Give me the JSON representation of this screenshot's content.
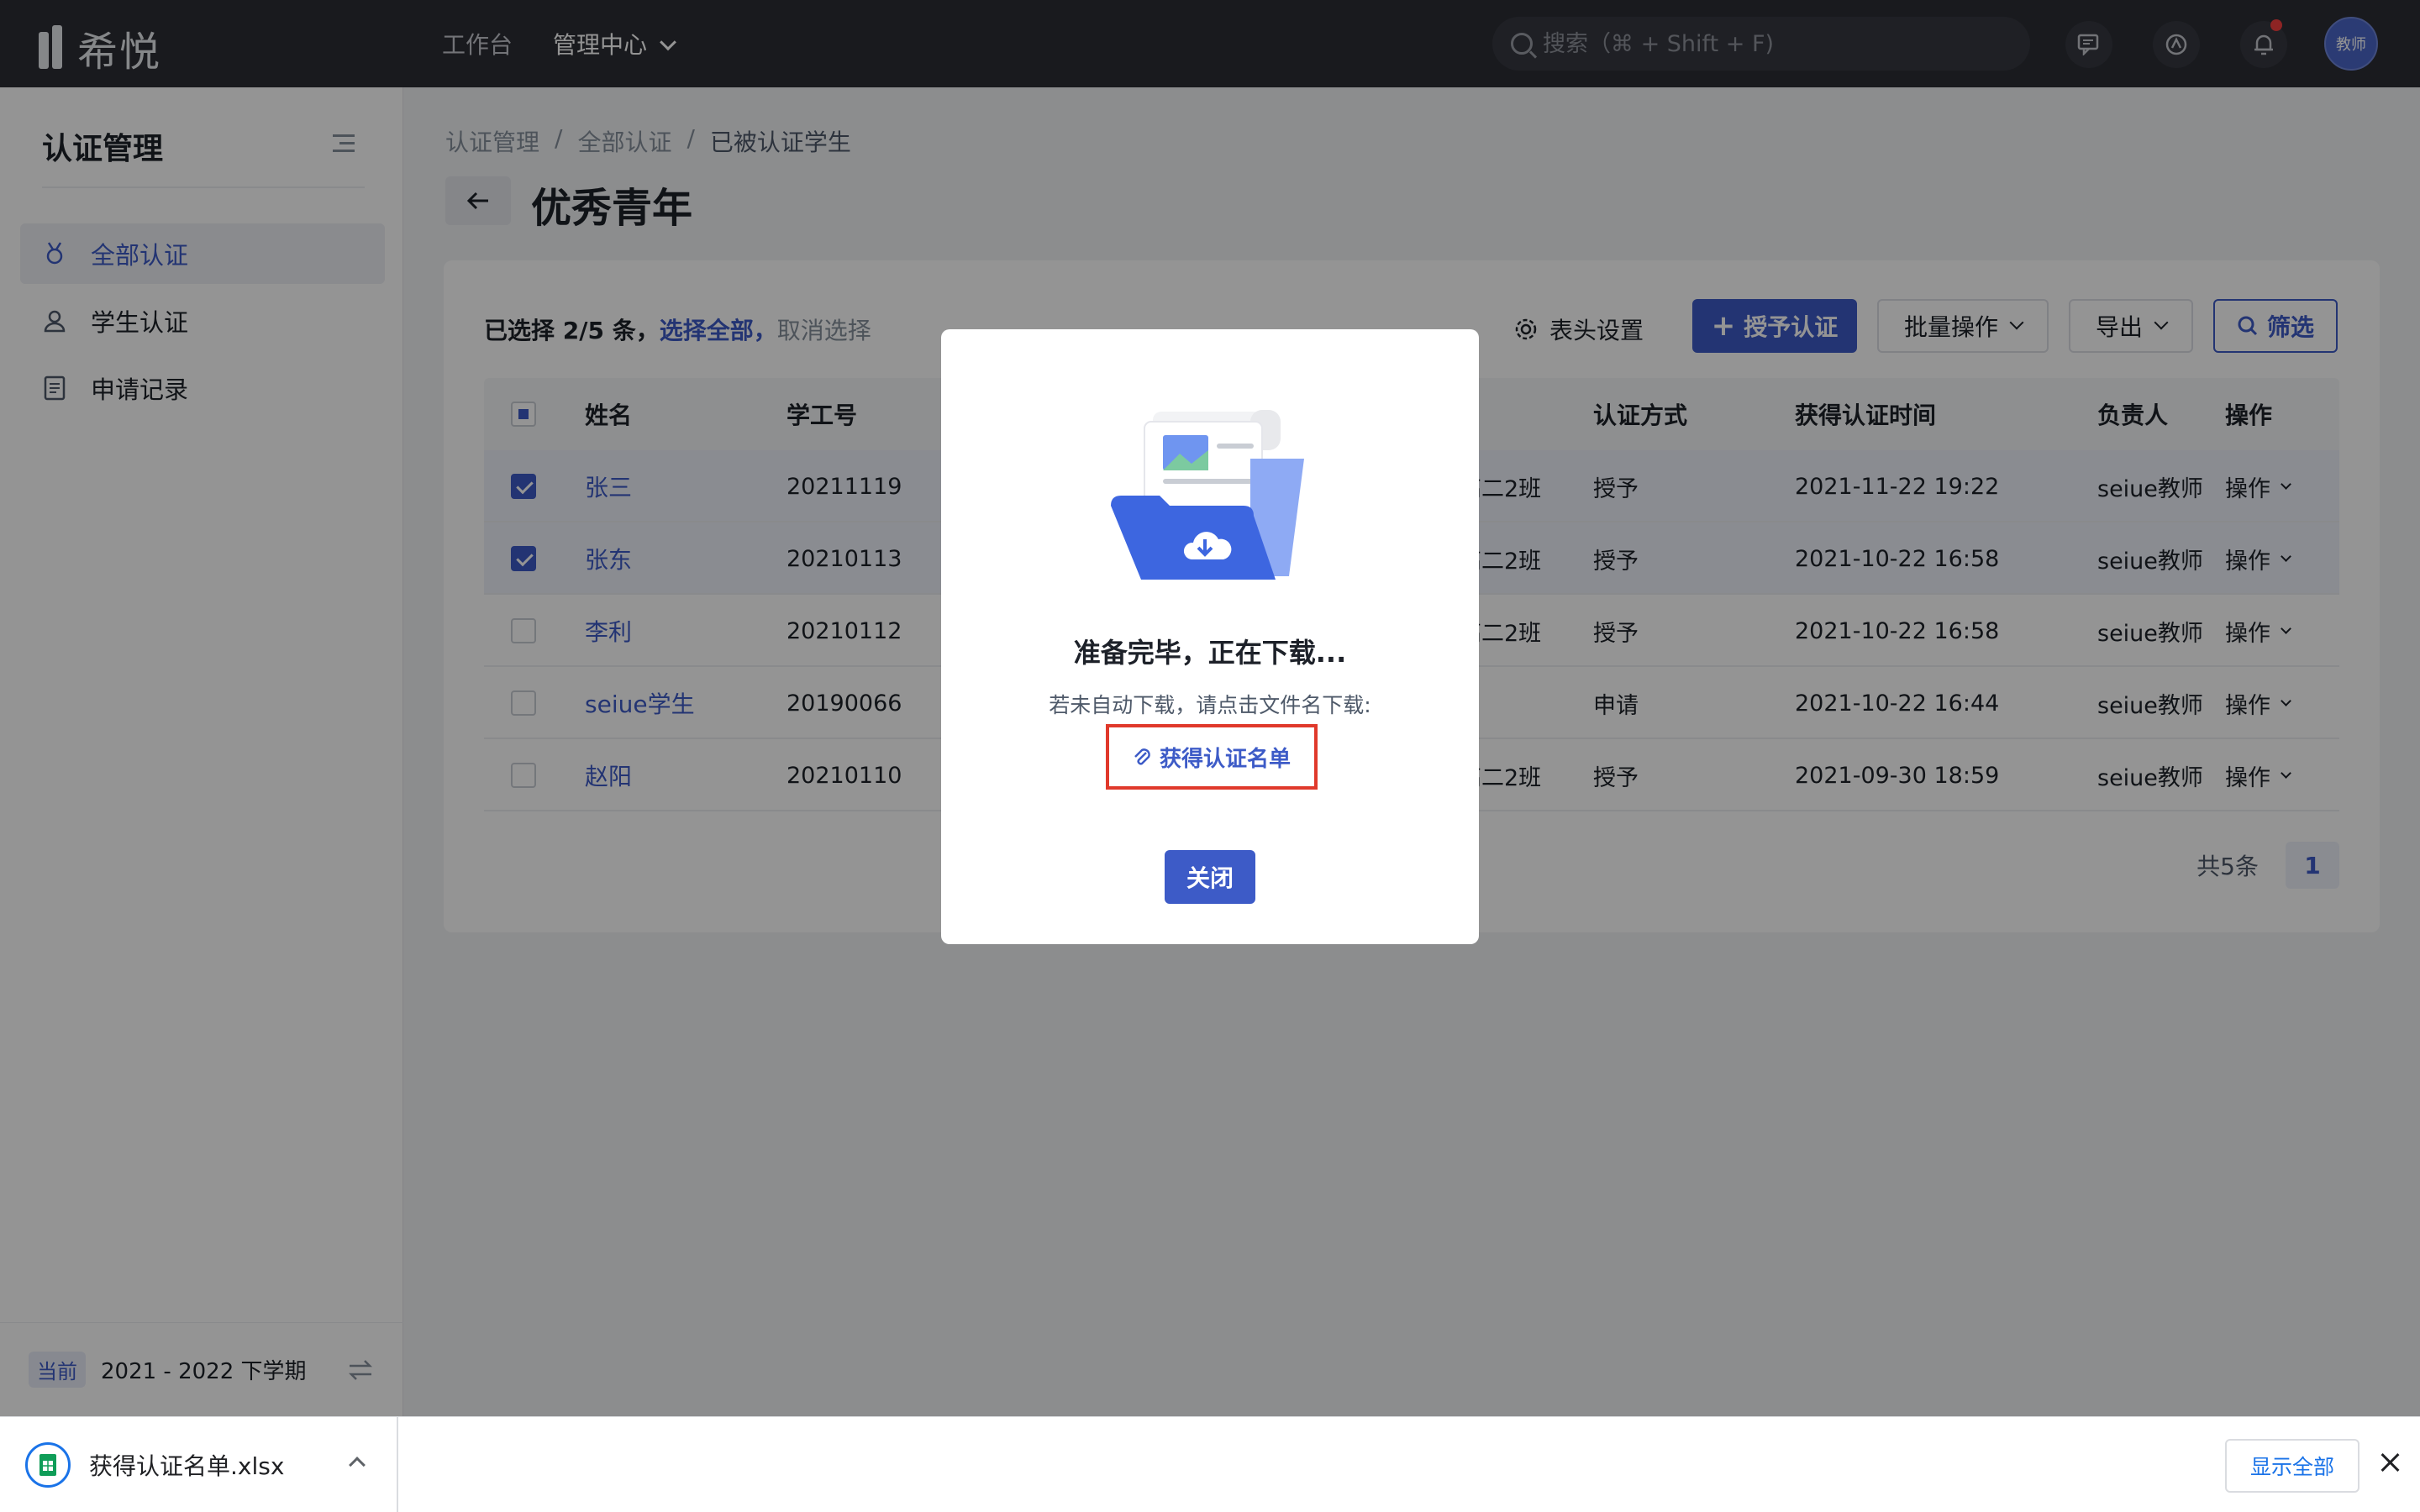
{
  "topbar": {
    "logo_text": "希悦",
    "nav": [
      {
        "label": "工作台"
      },
      {
        "label": "管理中心"
      }
    ],
    "search_placeholder": "搜索（⌘ + Shift + F)",
    "avatar_text": "教师"
  },
  "sidebar": {
    "title": "认证管理",
    "items": [
      {
        "label": "全部认证"
      },
      {
        "label": "学生认证"
      },
      {
        "label": "申请记录"
      }
    ],
    "semester_badge": "当前",
    "semester_text": "2021 - 2022 下学期"
  },
  "breadcrumb": [
    "认证管理",
    "/",
    "全部认证",
    "/",
    "已被认证学生"
  ],
  "page_title": "优秀青年",
  "selection": {
    "prefix": "已选择 2/5 条，",
    "select_all": "选择全部，",
    "cancel": "取消选择"
  },
  "toolbar": {
    "column_settings": "表头设置",
    "grant": "授予认证",
    "batch": "批量操作",
    "export": "导出",
    "filter": "筛选"
  },
  "table": {
    "headers": {
      "name": "姓名",
      "id": "学工号",
      "method": "认证方式",
      "time": "获得认证时间",
      "owner": "负责人",
      "op": "操作"
    },
    "rows": [
      {
        "name": "张三",
        "id": "20211119",
        "class": "高二2班",
        "method": "授予",
        "time": "2021-11-22 19:22",
        "owner": "seiue教师",
        "op": "操作",
        "checked": true
      },
      {
        "name": "张东",
        "id": "20210113",
        "class": "高二2班",
        "method": "授予",
        "time": "2021-10-22 16:58",
        "owner": "seiue教师",
        "op": "操作",
        "checked": true
      },
      {
        "name": "李利",
        "id": "20210112",
        "class": "高二2班",
        "method": "授予",
        "time": "2021-10-22 16:58",
        "owner": "seiue教师",
        "op": "操作",
        "checked": false
      },
      {
        "name": "seiue学生",
        "id": "20190066",
        "class": "",
        "method": "申请",
        "time": "2021-10-22 16:44",
        "owner": "seiue教师",
        "op": "操作",
        "checked": false
      },
      {
        "name": "赵阳",
        "id": "20210110",
        "class": "高二2班",
        "method": "授予",
        "time": "2021-09-30 18:59",
        "owner": "seiue教师",
        "op": "操作",
        "checked": false
      }
    ]
  },
  "pager": {
    "total": "共5条",
    "current": "1"
  },
  "modal": {
    "title": "准备完毕，正在下载...",
    "desc": "若未自动下载，请点击文件名下载:",
    "file_link": "获得认证名单",
    "close": "关闭"
  },
  "download_bar": {
    "file_name": "获得认证名单.xlsx",
    "show_all": "显示全部"
  },
  "colors": {
    "primary": "#3d5bc7",
    "topbar": "#2b2d34",
    "highlight_border": "#e0392b"
  }
}
